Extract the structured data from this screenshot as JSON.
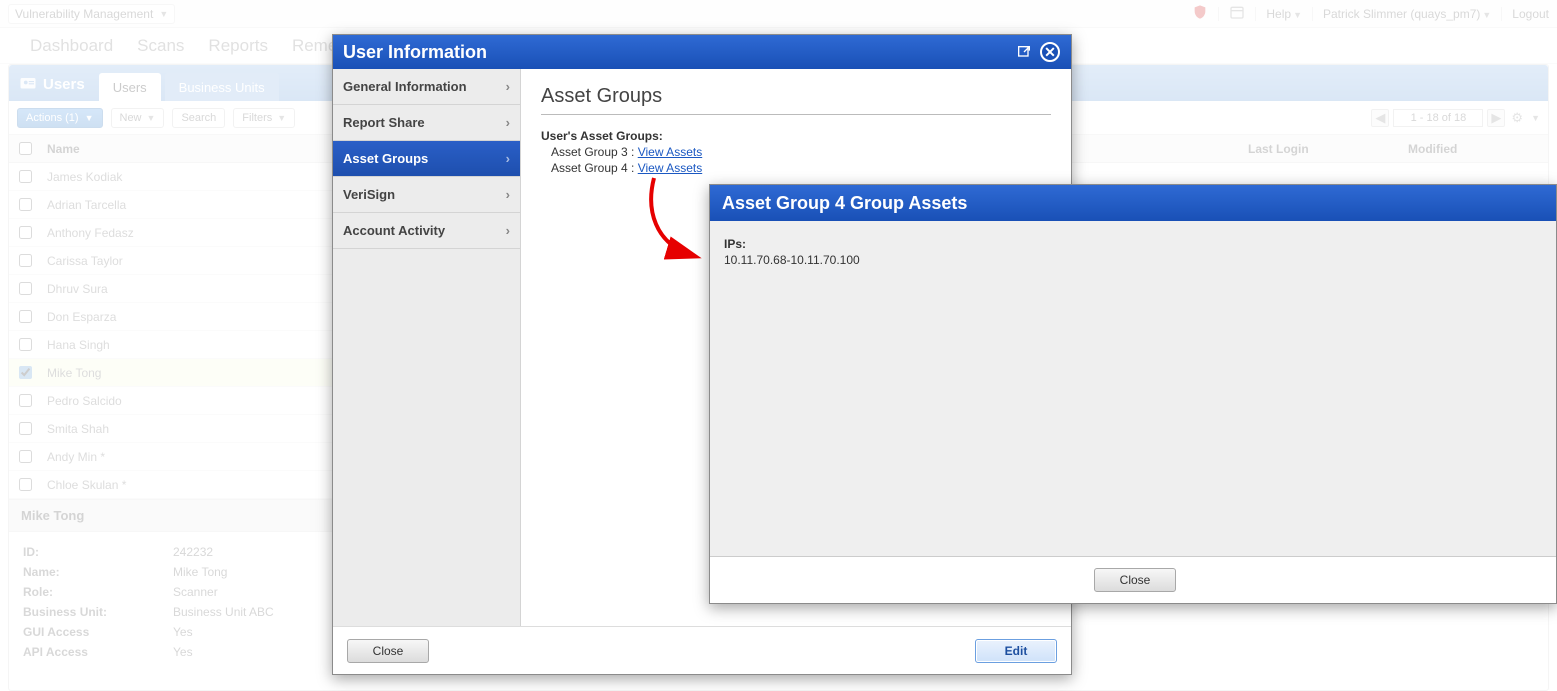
{
  "topbar": {
    "module": "Vulnerability Management",
    "help": "Help",
    "user": "Patrick Slimmer (quays_pm7)",
    "logout": "Logout"
  },
  "mainnav": [
    "Dashboard",
    "Scans",
    "Reports",
    "Remediation"
  ],
  "tabs": {
    "title": "Users",
    "items": [
      "Users",
      "Business Units"
    ],
    "active": 0
  },
  "toolbar": {
    "actions": "Actions (1)",
    "new": "New",
    "search": "Search",
    "filters": "Filters",
    "pager": "1 - 18 of 18"
  },
  "tableHead": {
    "name": "Name",
    "lastLogin": "Last Login",
    "modified": "Modified"
  },
  "users": [
    {
      "name": "James Kodiak",
      "checked": false
    },
    {
      "name": "Adrian Tarcella",
      "checked": false
    },
    {
      "name": "Anthony Fedasz",
      "checked": false
    },
    {
      "name": "Carissa Taylor",
      "checked": false
    },
    {
      "name": "Dhruv Sura",
      "checked": false
    },
    {
      "name": "Don Esparza",
      "checked": false
    },
    {
      "name": "Hana Singh",
      "checked": false
    },
    {
      "name": "Mike Tong",
      "checked": true
    },
    {
      "name": "Pedro Salcido",
      "checked": false
    },
    {
      "name": "Smita Shah",
      "checked": false
    },
    {
      "name": "Andy Min *",
      "checked": false
    },
    {
      "name": "Chloe Skulan *",
      "checked": false
    }
  ],
  "detail": {
    "title": "Mike Tong",
    "rows": [
      {
        "k": "ID:",
        "v": "242232"
      },
      {
        "k": "Name:",
        "v": "Mike Tong"
      },
      {
        "k": "Role:",
        "v": "Scanner"
      },
      {
        "k": "Business Unit:",
        "v": "Business Unit ABC"
      },
      {
        "k": "GUI Access",
        "v": "Yes"
      },
      {
        "k": "API Access",
        "v": "Yes"
      }
    ]
  },
  "modal1": {
    "title": "User Information",
    "side": [
      "General Information",
      "Report Share",
      "Asset Groups",
      "VeriSign",
      "Account Activity"
    ],
    "sideActive": 2,
    "heading": "Asset Groups",
    "subheading": "User's Asset Groups:",
    "groups": [
      {
        "label": "Asset Group 3 :",
        "link": "View Assets"
      },
      {
        "label": "Asset Group 4 :",
        "link": "View Assets"
      }
    ],
    "close": "Close",
    "edit": "Edit"
  },
  "modal2": {
    "title": "Asset Group 4 Group Assets",
    "ipsLabel": "IPs:",
    "ips": "10.11.70.68-10.11.70.100",
    "close": "Close"
  }
}
